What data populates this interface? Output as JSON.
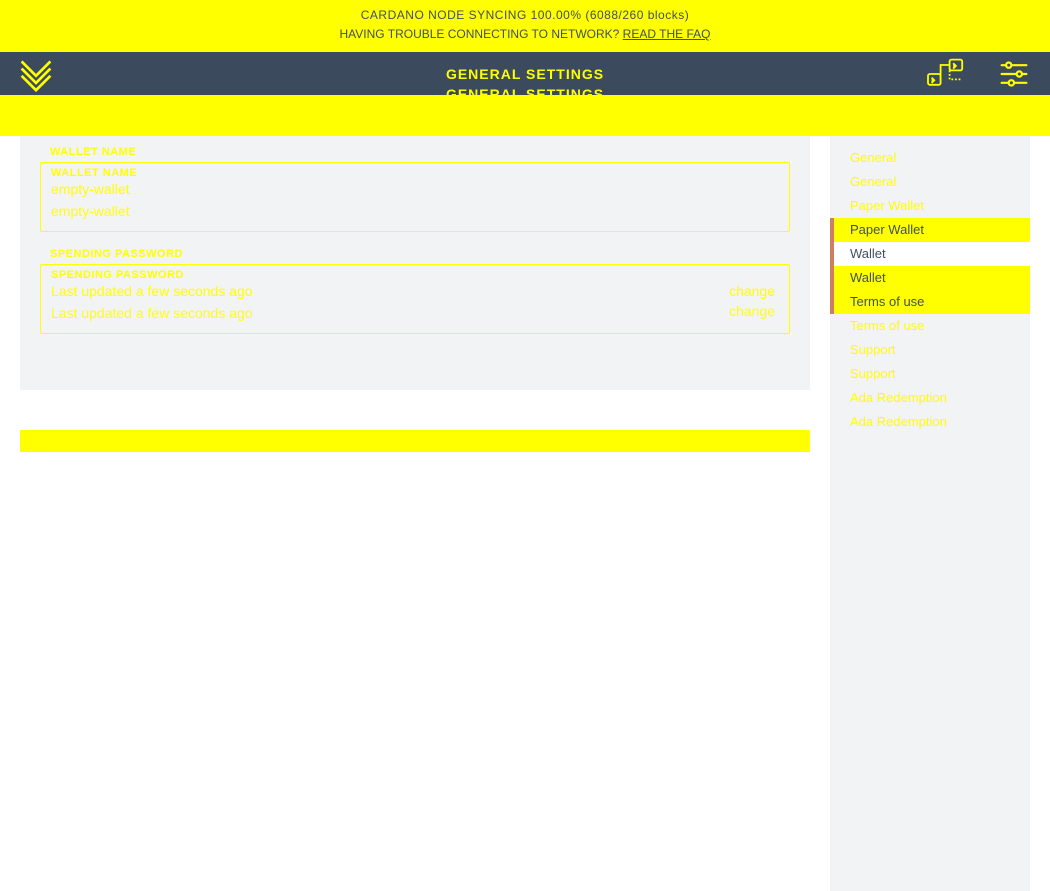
{
  "banner": {
    "line1": "CARDANO NODE SYNCING 100.00% (6088/260 blocks)",
    "line2_prefix": "HAVING TROUBLE CONNECTING TO NETWORK? ",
    "faq": "READ THE FAQ"
  },
  "topbar": {
    "title": "GENERAL SETTINGS",
    "title_echo": "GENERAL SETTINGS"
  },
  "panel": {
    "wallet_name_label_outer": "WALLET NAME",
    "wallet_name_label_inner": "WALLET NAME",
    "wallet_name_value": "empty-wallet",
    "wallet_name_echo": "empty-wallet",
    "spending_label_outer": "SPENDING PASSWORD",
    "spending_label_inner": "SPENDING PASSWORD",
    "spending_value": "Last updated a few seconds ago",
    "spending_echo": "Last updated a few seconds ago",
    "change": "change",
    "change_echo": "change"
  },
  "sidebar": {
    "items": [
      {
        "label": "General",
        "state": "normal"
      },
      {
        "label": "General",
        "state": "normal"
      },
      {
        "label": "Paper Wallet",
        "state": "normal"
      },
      {
        "label": "Paper Wallet",
        "state": "active-yellow"
      },
      {
        "label": "Wallet",
        "state": "active-white"
      },
      {
        "label": "Wallet",
        "state": "active-yellow"
      },
      {
        "label": "Terms of use",
        "state": "active-yellow"
      },
      {
        "label": "Terms of use",
        "state": "normal"
      },
      {
        "label": "Support",
        "state": "normal"
      },
      {
        "label": "Support",
        "state": "normal"
      },
      {
        "label": "Ada Redemption",
        "state": "normal"
      },
      {
        "label": "Ada Redemption",
        "state": "normal"
      }
    ]
  }
}
